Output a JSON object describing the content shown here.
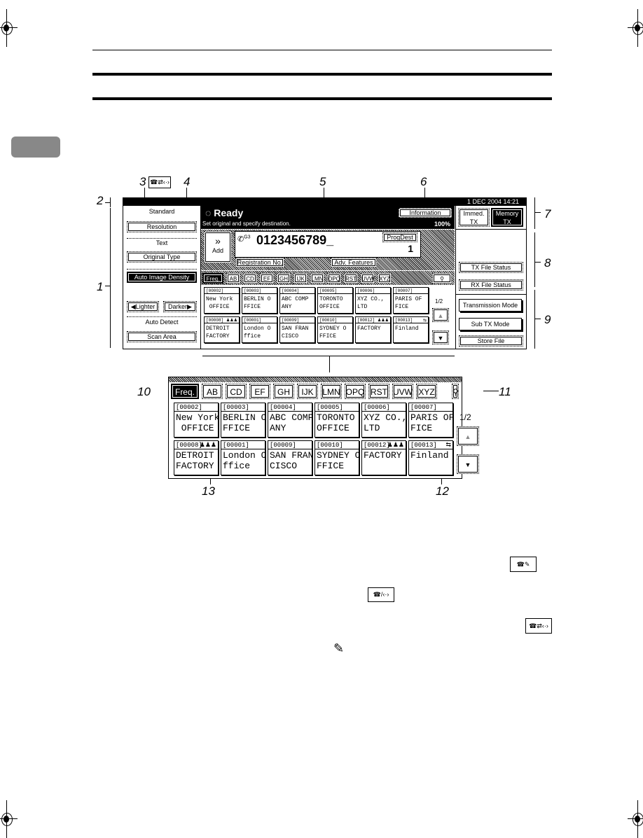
{
  "screen": {
    "date_time": "1  DEC   2004 14:21",
    "status": {
      "title": "Ready",
      "message": "Set original and specify destination.",
      "memory_percent": "100%"
    },
    "information_button": "Information",
    "left_panel": {
      "resolution_value": "Standard",
      "resolution_button": "Resolution",
      "original_type_value": "Text",
      "original_type_button": "Original Type",
      "auto_density_button": "Auto Image Density",
      "lighter_button": "◀Lighter",
      "darker_button": "Darker▶",
      "scan_area_value": "Auto Detect",
      "scan_area_button": "Scan Area"
    },
    "destination": {
      "add_button_icon": "»",
      "add_button_label": "Add",
      "line_label": "G3",
      "number": "0123456789_",
      "prog_dest_button": "ProgDest",
      "count": "1",
      "registration_button": "Registration No.",
      "adv_features_button": "Adv. Features"
    },
    "tabs": [
      "Freq.",
      "AB",
      "CD",
      "EF",
      "GH",
      "IJK",
      "LMN",
      "OPQ",
      "RST",
      "UVW",
      "XYZ"
    ],
    "page_indicator": "1/2",
    "destinations": [
      {
        "code": "[00002]",
        "name": "New York\n OFFICE",
        "icon": ""
      },
      {
        "code": "[00003]",
        "name": "BERLIN O\nFFICE",
        "icon": ""
      },
      {
        "code": "[00004]",
        "name": "ABC COMP\nANY",
        "icon": ""
      },
      {
        "code": "[00005]",
        "name": "TORONTO\nOFFICE",
        "icon": ""
      },
      {
        "code": "[00006]",
        "name": "XYZ CO.,\nLTD",
        "icon": ""
      },
      {
        "code": "[00007]",
        "name": "PARIS OF\nFICE",
        "icon": ""
      },
      {
        "code": "[00008]",
        "name": "DETROIT\nFACTORY",
        "icon": "group-icon"
      },
      {
        "code": "[00001]",
        "name": "London O\nffice",
        "icon": ""
      },
      {
        "code": "[00009]",
        "name": "SAN FRAN\nCISCO",
        "icon": ""
      },
      {
        "code": "[00010]",
        "name": "SYDNEY O\nFFICE",
        "icon": ""
      },
      {
        "code": "[00012]",
        "name": "FACTORY",
        "icon": "group-icon"
      },
      {
        "code": "[00013]",
        "name": "Finland",
        "icon": "fax-ip-icon"
      }
    ],
    "right_panel": {
      "immed_tx": "Immed.\nTX",
      "memory_tx": "Memory\nTX",
      "tx_file_status": "TX File Status",
      "rx_file_status": "RX File Status",
      "transmission_mode": "Transmission Mode",
      "sub_tx_mode": "Sub TX Mode",
      "store_file": "Store File"
    }
  },
  "callouts": [
    "1",
    "2",
    "3",
    "4",
    "5",
    "6",
    "7",
    "8",
    "9",
    "10",
    "11",
    "12",
    "13"
  ],
  "icons": {
    "group": "♟♟♟",
    "search": "⚲",
    "up": "▲",
    "down": "▼",
    "fax_internet": "☎⇄‹·›",
    "fax_mail": "☎/‹·›",
    "fax_phone": "☎✎",
    "note": "✎"
  }
}
